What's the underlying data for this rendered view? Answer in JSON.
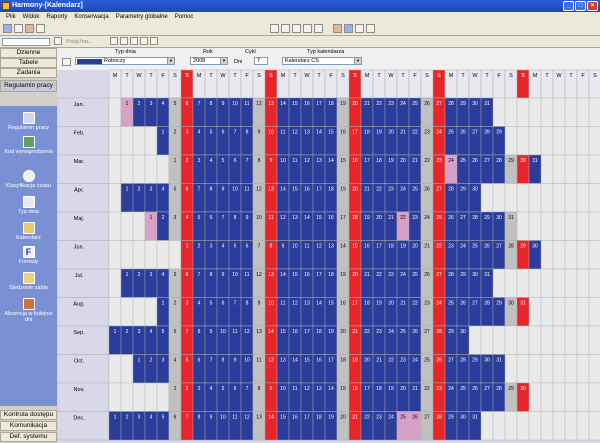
{
  "window": {
    "title": "Harmony-[Kalendarz]"
  },
  "menu": [
    "Plik",
    "Widok",
    "Raporty",
    "Konserwacja",
    "Parametry globalne",
    "Pomoc"
  ],
  "toolbar": {
    "search_hint": "Podaj fraz..."
  },
  "sidebar": {
    "top_buttons": [
      "Dzienne",
      "Tabele",
      "Zadania",
      "Regulamin pracy"
    ],
    "items": [
      {
        "label": "Regulamin pracy",
        "icon": "calendar-icon"
      },
      {
        "label": "Kod wynagrodzenia",
        "icon": "money-icon"
      },
      {
        "label": "Klasyfikacja czasu",
        "icon": "clock-icon"
      },
      {
        "label": "Typ dnia",
        "icon": "day-type-icon"
      },
      {
        "label": "Kalendarz",
        "icon": "folder-icon"
      },
      {
        "label": "Formuły",
        "icon": "formula-icon"
      },
      {
        "label": "Śledzenie salda",
        "icon": "balance-icon"
      },
      {
        "label": "Absencja w kolejnie dni",
        "icon": "absence-icon"
      }
    ],
    "bottom_buttons": [
      "Kontrola dostępu",
      "Komunikacja",
      "Def. systemu"
    ]
  },
  "filters": {
    "typ_dnia_label": "Typ dnia",
    "typ_dnia_value": "Roboczy",
    "rok_label": "Rok",
    "rok_value": "2008",
    "cykl_label": "Cykl",
    "dni_label": "Dni",
    "dni_value": "7",
    "typ_kal_label": "Typ kalendarza",
    "typ_kal_value": "Kalendarz CS"
  },
  "calendar": {
    "day_headers": [
      "M",
      "T",
      "W",
      "T",
      "F",
      "S",
      "S",
      "M",
      "T",
      "W",
      "T",
      "F",
      "S",
      "S",
      "M",
      "T",
      "W",
      "T",
      "F",
      "S",
      "S",
      "M",
      "T",
      "W",
      "T",
      "F",
      "S",
      "S",
      "M",
      "T",
      "W",
      "T",
      "F",
      "S",
      "S",
      "M",
      "T",
      "W",
      "T",
      "F",
      "S",
      "S"
    ],
    "colors": {
      "work": "#2b3d9c",
      "sat": "#c0c0c0",
      "sun": "#e8262a",
      "special": "#d8a0c8",
      "empty": "#eaeaea",
      "border": "#b0b0b0"
    },
    "months": [
      {
        "label": "Jan.",
        "first_col": 1,
        "days": 31,
        "special": [
          1
        ]
      },
      {
        "label": "Feb.",
        "first_col": 4,
        "days": 29,
        "special": []
      },
      {
        "label": "Mar.",
        "first_col": 5,
        "days": 31,
        "special": [
          24
        ]
      },
      {
        "label": "Apr.",
        "first_col": 1,
        "days": 30,
        "special": []
      },
      {
        "label": "Maj.",
        "first_col": 3,
        "days": 31,
        "special": [
          1,
          22
        ]
      },
      {
        "label": "Jun.",
        "first_col": 6,
        "days": 30,
        "special": []
      },
      {
        "label": "Jul.",
        "first_col": 1,
        "days": 31,
        "special": []
      },
      {
        "label": "Aug.",
        "first_col": 4,
        "days": 31,
        "special": []
      },
      {
        "label": "Sep.",
        "first_col": 0,
        "days": 30,
        "special": []
      },
      {
        "label": "Oct.",
        "first_col": 2,
        "days": 31,
        "special": []
      },
      {
        "label": "Nov.",
        "first_col": 5,
        "days": 30,
        "special": []
      },
      {
        "label": "Dec.",
        "first_col": 0,
        "days": 31,
        "special": [
          25,
          26
        ]
      }
    ]
  }
}
